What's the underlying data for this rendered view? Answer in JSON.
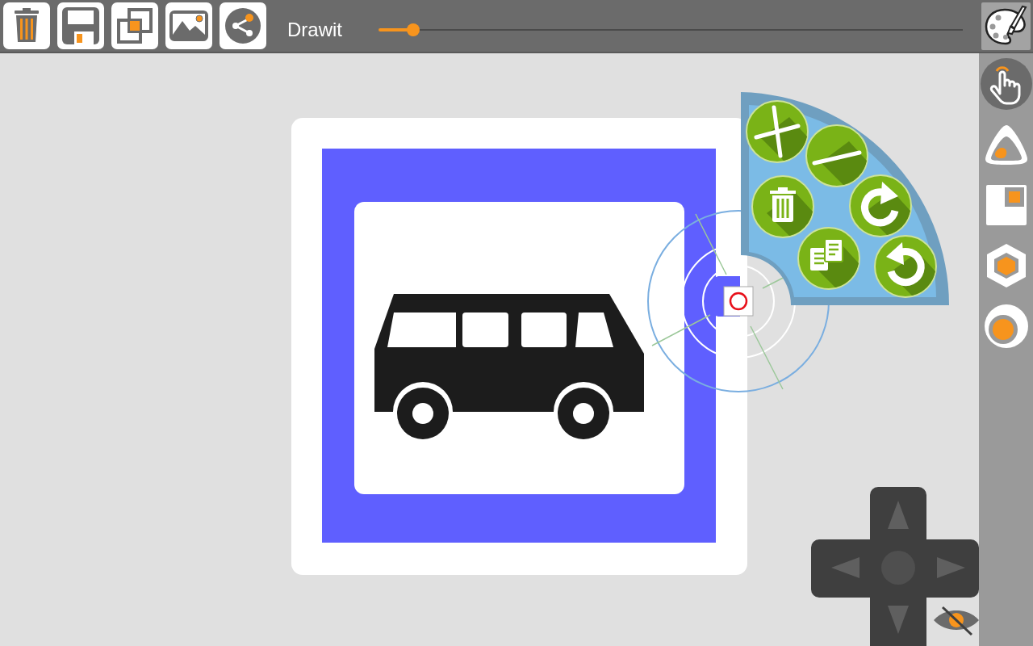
{
  "toolbar": {
    "title": "Drawit",
    "slider": {
      "level": 0.06
    }
  },
  "tools": [
    {
      "kind": "hand",
      "selected": true
    },
    {
      "kind": "triangle",
      "selected": false
    },
    {
      "kind": "square",
      "selected": false
    },
    {
      "kind": "hexagon",
      "selected": false
    },
    {
      "kind": "circle",
      "selected": false
    }
  ]
}
